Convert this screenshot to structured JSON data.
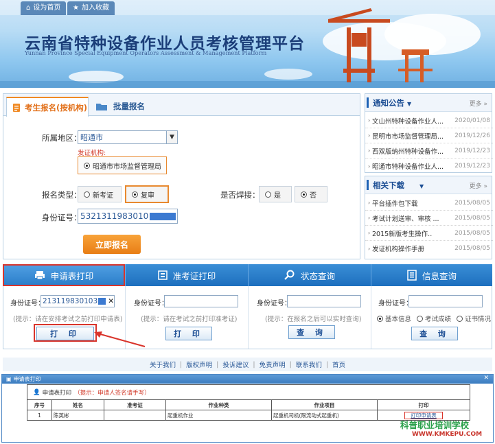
{
  "top_links": {
    "home": "设为首页",
    "favorite": "加入收藏"
  },
  "banner": {
    "title": "云南省特种设备作业人员考核管理平台",
    "subtitle": "Yunnan Province Special Equipment Operators Assessment & Management Platform"
  },
  "registration": {
    "tab_active": "考生报名(按机构)",
    "tab_batch": "批量报名",
    "region_label": "所属地区：",
    "region_value": "昭通市",
    "issuer_label": "发证机构:",
    "issuer_value": "昭通市市场监督管理局",
    "type_label": "报名类型：",
    "type_new": "新考证",
    "type_review": "复审",
    "weld_label": "是否焊接：",
    "weld_yes": "是",
    "weld_no": "否",
    "id_label": "身份证号：",
    "id_value": "5321311983010",
    "submit_label": "立即报名"
  },
  "notices": {
    "title": "通知公告",
    "more": "更多",
    "items": [
      {
        "text": "文山州特种设备作业人...",
        "date": "2020/01/08"
      },
      {
        "text": "昆明市市场监督管理局...",
        "date": "2019/12/26"
      },
      {
        "text": "西双版纳州特种设备作...",
        "date": "2019/12/23"
      },
      {
        "text": "昭通市特种设备作业人...",
        "date": "2019/12/23"
      }
    ]
  },
  "downloads": {
    "title": "相关下载",
    "more": "更多",
    "items": [
      {
        "text": "平台插件包下载",
        "date": "2015/08/05"
      },
      {
        "text": "考试计划送审、审核 ...",
        "date": "2015/08/05"
      },
      {
        "text": "2015新版考生操作..",
        "date": "2015/08/05"
      },
      {
        "text": "发证机构操作手册",
        "date": "2015/08/05"
      }
    ]
  },
  "query_tabs": [
    {
      "label": "申请表打印"
    },
    {
      "label": "准考证打印"
    },
    {
      "label": "状态查询"
    },
    {
      "label": "信息查询"
    }
  ],
  "query_cols": {
    "id_label": "身份证号：",
    "col1_value": "213119830103",
    "col1_hint": "(提示：请在安排考试之前打印申请表)",
    "col1_btn": "打 印",
    "col2_hint": "(提示：请在考试之前打印准考证)",
    "col2_btn": "打 印",
    "col3_hint": "(提示：在报名之后可以实时查询)",
    "col3_btn": "查 询",
    "col4_opt1": "基本信息",
    "col4_opt2": "考试成绩",
    "col4_opt3": "证书情况",
    "col4_btn": "查 询"
  },
  "footer_links": [
    "关于我们",
    "版权声明",
    "投诉建议",
    "免责声明",
    "联系我们",
    "首页"
  ],
  "dialog": {
    "title": "申请表打印",
    "section": "申请表打印",
    "section_hint": "（提示：申请人签名请手写）",
    "headers": [
      "序号",
      "姓名",
      "准考证",
      "作业种类",
      "作业项目",
      "打印"
    ],
    "row": [
      "1",
      "陈英彬",
      "",
      "起重机作业",
      "起重机司机(限流动式起重机)",
      "打印申请表"
    ]
  },
  "watermark": {
    "name": "科普职业培训学校",
    "url": "WWW.KMKEPU.COM"
  }
}
